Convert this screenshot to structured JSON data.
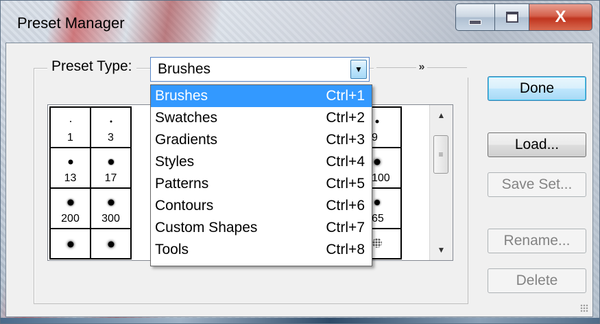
{
  "window": {
    "title": "Preset Manager",
    "close_glyph": "X"
  },
  "preset_type": {
    "label": "Preset Type:",
    "selected": "Brushes",
    "expand_glyph": "»"
  },
  "dropdown_items": [
    {
      "label": "Brushes",
      "shortcut": "Ctrl+1",
      "selected": true
    },
    {
      "label": "Swatches",
      "shortcut": "Ctrl+2"
    },
    {
      "label": "Gradients",
      "shortcut": "Ctrl+3"
    },
    {
      "label": "Styles",
      "shortcut": "Ctrl+4"
    },
    {
      "label": "Patterns",
      "shortcut": "Ctrl+5"
    },
    {
      "label": "Contours",
      "shortcut": "Ctrl+6"
    },
    {
      "label": "Custom Shapes",
      "shortcut": "Ctrl+7"
    },
    {
      "label": "Tools",
      "shortcut": "Ctrl+8"
    }
  ],
  "brushes": {
    "col1": [
      "1",
      "13",
      "200",
      ""
    ],
    "col2": [
      "3",
      "17",
      "300",
      ""
    ],
    "col3": [
      "9",
      "100",
      "65",
      ""
    ]
  },
  "buttons": {
    "done": "Done",
    "load": "Load...",
    "save_set": "Save Set...",
    "rename": "Rename...",
    "delete": "Delete"
  },
  "colors": {
    "selection": "#3399ff",
    "close_button": "#c0351f"
  }
}
